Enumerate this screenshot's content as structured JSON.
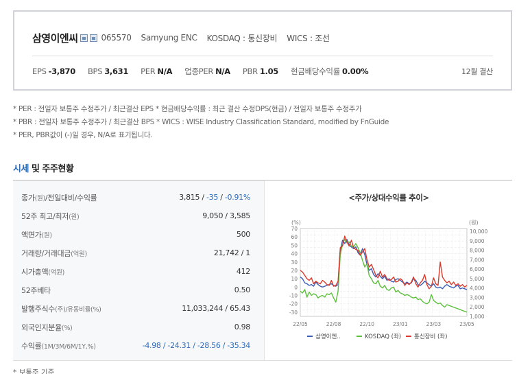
{
  "company": {
    "name": "삼영이엔씨",
    "code": "065570",
    "english_name": "Samyung ENC",
    "market": "KOSDAQ : 통신장비",
    "wics": "WICS : 조선"
  },
  "metrics": [
    {
      "label": "EPS",
      "value": "-3,870"
    },
    {
      "label": "BPS",
      "value": "3,631"
    },
    {
      "label": "PER",
      "value": "N/A"
    },
    {
      "label": "업종PER",
      "value": "N/A"
    },
    {
      "label": "PBR",
      "value": "1.05"
    },
    {
      "label": "현금배당수익률",
      "value": "0.00%"
    }
  ],
  "settlement": "12월 결산",
  "notes": [
    "* PER : 전일자 보통주 수정주가 / 최근결산 EPS * 현금배당수익률 : 최근 결산 수정DPS(현금) / 전일자 보통주 수정주가",
    "* PBR : 전일자 보통주 수정주가 / 최근결산 BPS * WICS : WISE Industry Classification Standard, modified by FnGuide",
    "* PER, PBR값이 (-)일 경우, N/A로 표기됩니다."
  ],
  "section": {
    "title_highlight": "시세",
    "title_rest": " 및 주주현황"
  },
  "market_rows": [
    {
      "label": "종가",
      "unit": "(원)",
      "suffix": "/전일대비/수익률",
      "value": "3,815 / ",
      "neg1": "-35",
      "sep": " / ",
      "neg2": "-0.91%"
    },
    {
      "label": "52주 최고/최저",
      "unit": "(원)",
      "suffix": "",
      "value": "9,050 / 3,585"
    },
    {
      "label": "액면가",
      "unit": "(원)",
      "suffix": "",
      "value": "500"
    },
    {
      "label": "거래량/거래대금",
      "unit": "(억원)",
      "suffix": "",
      "value": "21,742 / 1"
    },
    {
      "label": "시가총액",
      "unit": "(억원)",
      "suffix": "",
      "value": "412"
    },
    {
      "label": "52주베타",
      "unit": "",
      "suffix": "",
      "value": "0.50"
    },
    {
      "label": "발행주식수",
      "unit": "(주)",
      "suffix": "/유동비율(%)",
      "value": "11,033,244 / 65.43"
    },
    {
      "label": "외국인지분율",
      "unit": "(%)",
      "suffix": "",
      "value": "0.98"
    },
    {
      "label": "수익률",
      "unit": "(1M/3M/6M/1Y,%)",
      "suffix": "",
      "value": "-4.98 / -24.31 / -28.56 / -35.34"
    }
  ],
  "chart_data": {
    "type": "line",
    "title": "<주가/상대수익률 추이>",
    "y_left_unit": "(%)",
    "y_right_unit": "(원)",
    "y_left_ticks": [
      "70",
      "60",
      "50",
      "40",
      "30",
      "20",
      "10",
      "0",
      "-10",
      "-20",
      "-30"
    ],
    "y_right_ticks": [
      "10,000",
      "9,000",
      "8,000",
      "7,000",
      "6,000",
      "5,000",
      "4,000",
      "3,000",
      "2,000",
      "1,000"
    ],
    "x_ticks": [
      "22/05",
      "22/08",
      "22/10",
      "23/01",
      "23/03",
      "23/05"
    ],
    "ylim_left": [
      -35,
      70
    ],
    "colors": {
      "stock": "#3b5db5",
      "kosdaq": "#5cbf3c",
      "sector": "#d93a2b"
    },
    "series": [
      {
        "name": "삼영이엔..",
        "key": "stock",
        "color": "#3b5db5",
        "values": [
          12,
          10,
          5,
          4,
          2,
          3,
          1,
          6,
          3,
          1,
          0,
          1,
          2,
          3,
          4,
          2,
          1,
          3,
          44,
          56,
          52,
          57,
          50,
          48,
          46,
          48,
          41,
          38,
          46,
          39,
          27,
          20,
          22,
          15,
          12,
          16,
          13,
          10,
          13,
          8,
          10,
          7,
          6,
          9,
          10,
          8,
          6,
          4,
          6,
          4,
          5,
          10,
          8,
          3,
          2,
          4,
          7,
          5,
          3,
          1,
          4,
          0,
          -1,
          0,
          -2,
          1,
          3,
          1,
          0,
          -1,
          1,
          2,
          -2,
          -1,
          -2,
          -3
        ]
      },
      {
        "name": "KOSDAQ (좌)",
        "key": "kosdaq",
        "color": "#5cbf3c",
        "values": [
          -5,
          -7,
          -3,
          -12,
          -6,
          -10,
          -8,
          -9,
          -13,
          -11,
          -10,
          -12,
          -8,
          -9,
          -7,
          -13,
          -18,
          -5,
          38,
          52,
          57,
          53,
          54,
          49,
          48,
          52,
          47,
          41,
          32,
          24,
          28,
          14,
          10,
          5,
          4,
          8,
          1,
          -1,
          2,
          -3,
          -4,
          -1,
          0,
          -6,
          -4,
          -7,
          -8,
          -10,
          -9,
          -10,
          -12,
          -13,
          -12,
          -15,
          -14,
          -17,
          -19,
          -20,
          -18,
          -9,
          -16,
          -18,
          -20,
          -19,
          -22,
          -24,
          -21,
          -22,
          -23,
          -24,
          -25,
          -26,
          -27,
          -28,
          -29,
          -30
        ]
      },
      {
        "name": "통신장비 (좌)",
        "key": "sector",
        "color": "#d93a2b",
        "values": [
          20,
          18,
          14,
          10,
          8,
          11,
          4,
          7,
          5,
          4,
          8,
          6,
          3,
          2,
          8,
          1,
          2,
          7,
          47,
          49,
          61,
          54,
          49,
          56,
          47,
          45,
          44,
          38,
          42,
          46,
          33,
          24,
          27,
          21,
          14,
          11,
          19,
          12,
          15,
          10,
          8,
          9,
          12,
          6,
          7,
          10,
          8,
          2,
          5,
          3,
          6,
          12,
          4,
          0,
          5,
          8,
          15,
          3,
          -2,
          1,
          11,
          4,
          2,
          30,
          12,
          8,
          5,
          7,
          3,
          6,
          2,
          4,
          1,
          3,
          0,
          2
        ]
      }
    ]
  }
}
